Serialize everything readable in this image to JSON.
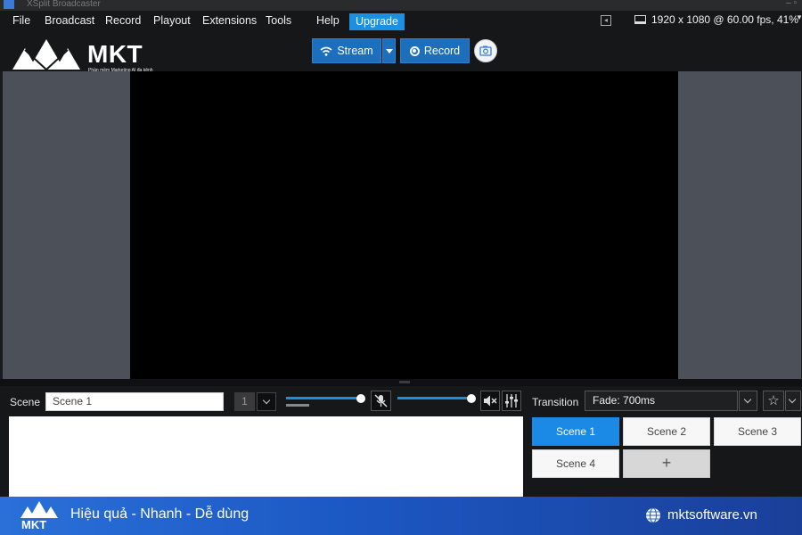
{
  "window": {
    "title": "XSplit Broadcaster"
  },
  "menu": {
    "items": [
      "File",
      "Broadcast",
      "Record",
      "Playout",
      "Extensions",
      "Tools",
      "Help"
    ],
    "upgrade_label": "Upgrade"
  },
  "status": {
    "resolution": "1920 x 1080 @ 60.00 fps, 41%"
  },
  "brand": {
    "logo_text": "MKT",
    "logo_tagline": "Phần mềm Marketing AI đa kênh",
    "footer_logo_text": "MKT",
    "footer_tagline": "Hiệu quả - Nhanh - Dễ dùng",
    "website": "mktsoftware.vn"
  },
  "toolbar": {
    "stream_label": "Stream",
    "record_label": "Record"
  },
  "scene_bar": {
    "label": "Scene",
    "scene_name": "Scene 1",
    "scene_number": "1",
    "volume_1": 0.95,
    "volume_2": 0.95
  },
  "transition": {
    "label": "Transition",
    "value": "Fade: 700ms"
  },
  "scenes": {
    "items": [
      "Scene 1",
      "Scene 2",
      "Scene 3",
      "Scene 4"
    ],
    "active": "Scene 1",
    "add_label": "+"
  },
  "colors": {
    "accent": "#1d8fe1",
    "active_scene": "#1a8ae6",
    "stage_side": "#4c5058",
    "footer_start": "#2a70d8",
    "footer_end": "#1a3f99"
  },
  "icons": [
    "app-icon",
    "wifi-icon",
    "caret-down-icon",
    "record-icon",
    "camera-icon",
    "pin-icon",
    "monitor-icon",
    "mic-muted-icon",
    "speaker-muted-icon",
    "mixer-icon",
    "star-icon",
    "chevron-down-icon",
    "globe-icon",
    "mkt-logo-icon"
  ]
}
